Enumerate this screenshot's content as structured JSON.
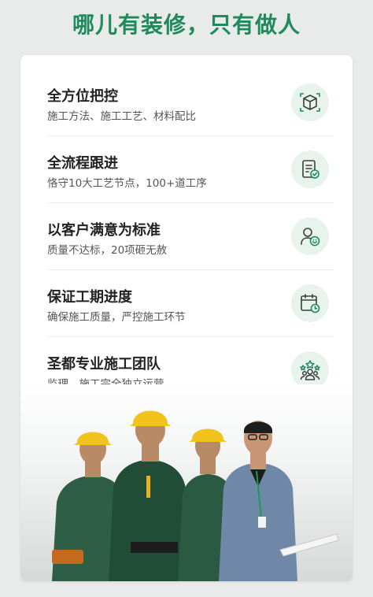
{
  "headline": "哪儿有装修，只有做人",
  "features": [
    {
      "title": "全方位把控",
      "subtitle": "施工方法、施工工艺、材料配比",
      "icon": "cube-icon"
    },
    {
      "title": "全流程跟进",
      "subtitle": "恪守10大工艺节点，100+道工序",
      "icon": "checklist-icon"
    },
    {
      "title": "以客户满意为标准",
      "subtitle": "质量不达标，20项砸无赦",
      "icon": "user-smile-icon"
    },
    {
      "title": "保证工期进度",
      "subtitle": "确保施工质量，严控施工环节",
      "icon": "calendar-clock-icon"
    },
    {
      "title": "圣都专业施工团队",
      "subtitle": "监理、施工完全独立运营",
      "icon": "team-star-icon"
    }
  ],
  "colors": {
    "accent": "#1f8a5c",
    "icon_bg": "#e8f3ee"
  }
}
